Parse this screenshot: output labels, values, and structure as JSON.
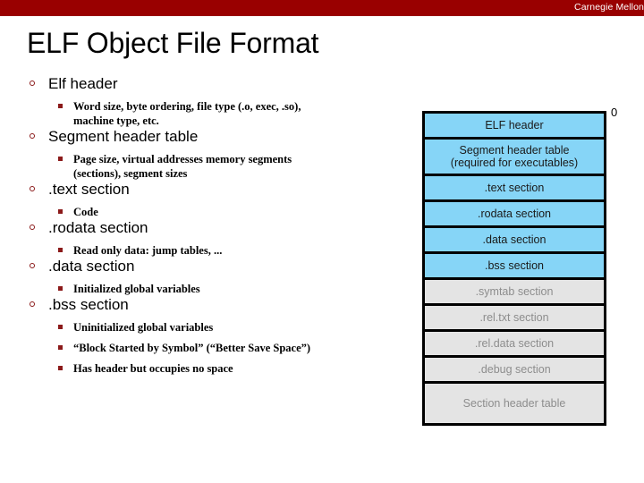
{
  "brand": {
    "name": "Carnegie Mellon",
    "bar_color": "#990000"
  },
  "title": "ELF Object File Format",
  "bullets": [
    {
      "label": "Elf header",
      "subs": [
        "Word size, byte ordering, file type (.o, exec, .so),",
        "machine type, etc."
      ]
    },
    {
      "label": "Segment header table",
      "subs": [
        "Page size, virtual addresses memory segments",
        "(sections), segment sizes"
      ]
    },
    {
      "label": ".text section",
      "subs": [
        "Code"
      ]
    },
    {
      "label": ".rodata section",
      "subs": [
        "Read only data: jump tables, ..."
      ]
    },
    {
      "label": ".data section",
      "subs": [
        "Initialized global variables"
      ]
    },
    {
      "label": ".bss section",
      "subs": [
        "Uninitialized global variables",
        "“Block Started by Symbol” (“Better Save Space”)",
        "Has header but occupies no space"
      ]
    }
  ],
  "diagram": {
    "offset_label": "0",
    "blue_color": "#86d5f7",
    "gray_color": "#e4e4e4",
    "rows": [
      {
        "label": "ELF header",
        "state": "blue"
      },
      {
        "label": "Segment header table\n(required for executables)",
        "state": "blue"
      },
      {
        "label": ".text section",
        "state": "blue"
      },
      {
        "label": ".rodata section",
        "state": "blue"
      },
      {
        "label": ".data section",
        "state": "blue"
      },
      {
        "label": ".bss section",
        "state": "blue"
      },
      {
        "label": ".symtab section",
        "state": "gray"
      },
      {
        "label": ".rel.txt section",
        "state": "gray"
      },
      {
        "label": ".rel.data section",
        "state": "gray"
      },
      {
        "label": ".debug section",
        "state": "gray"
      },
      {
        "label": "Section header table",
        "state": "gray"
      }
    ]
  }
}
